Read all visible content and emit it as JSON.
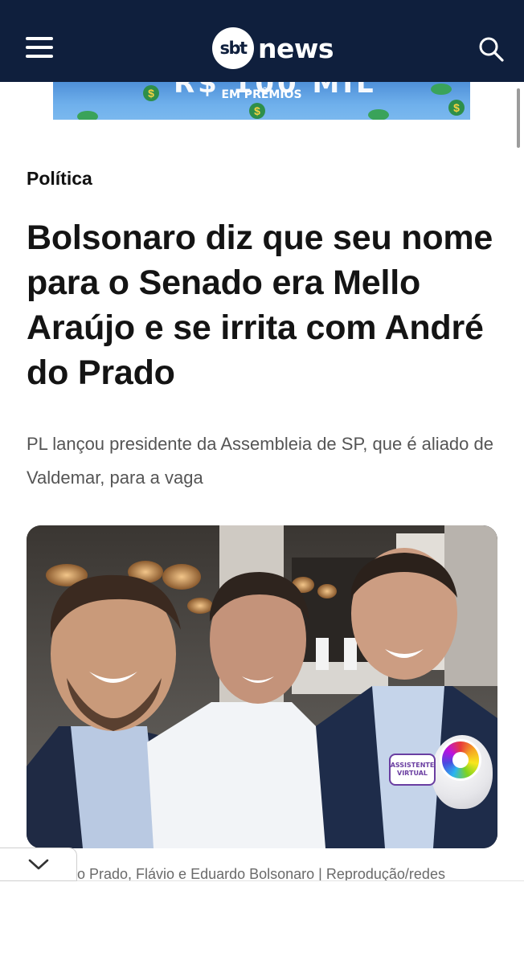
{
  "header": {
    "logo_mark": "sbt",
    "logo_text": "news",
    "menu_icon": "hamburger-icon",
    "search_icon": "search-icon",
    "background_color": "#0f1f3d"
  },
  "ad_banner": {
    "text": "EM PRÊMIOS"
  },
  "article": {
    "category": "Política",
    "headline": "Bolsonaro diz que seu nome para o Senado era Mello Araújo e se irrita com André do Prado",
    "subtitle": "PL lançou presidente da Assembleia de SP, que é aliado de Valdemar, para a vaga",
    "photo": {
      "badge_text_line1": "ASSISTENTE",
      "badge_text_line2": "VIRTUAL"
    },
    "caption": "o Prado, Flávio e Eduardo Bolsonaro | Reprodução/redes"
  },
  "collapse_icon": "chevron-down-icon"
}
